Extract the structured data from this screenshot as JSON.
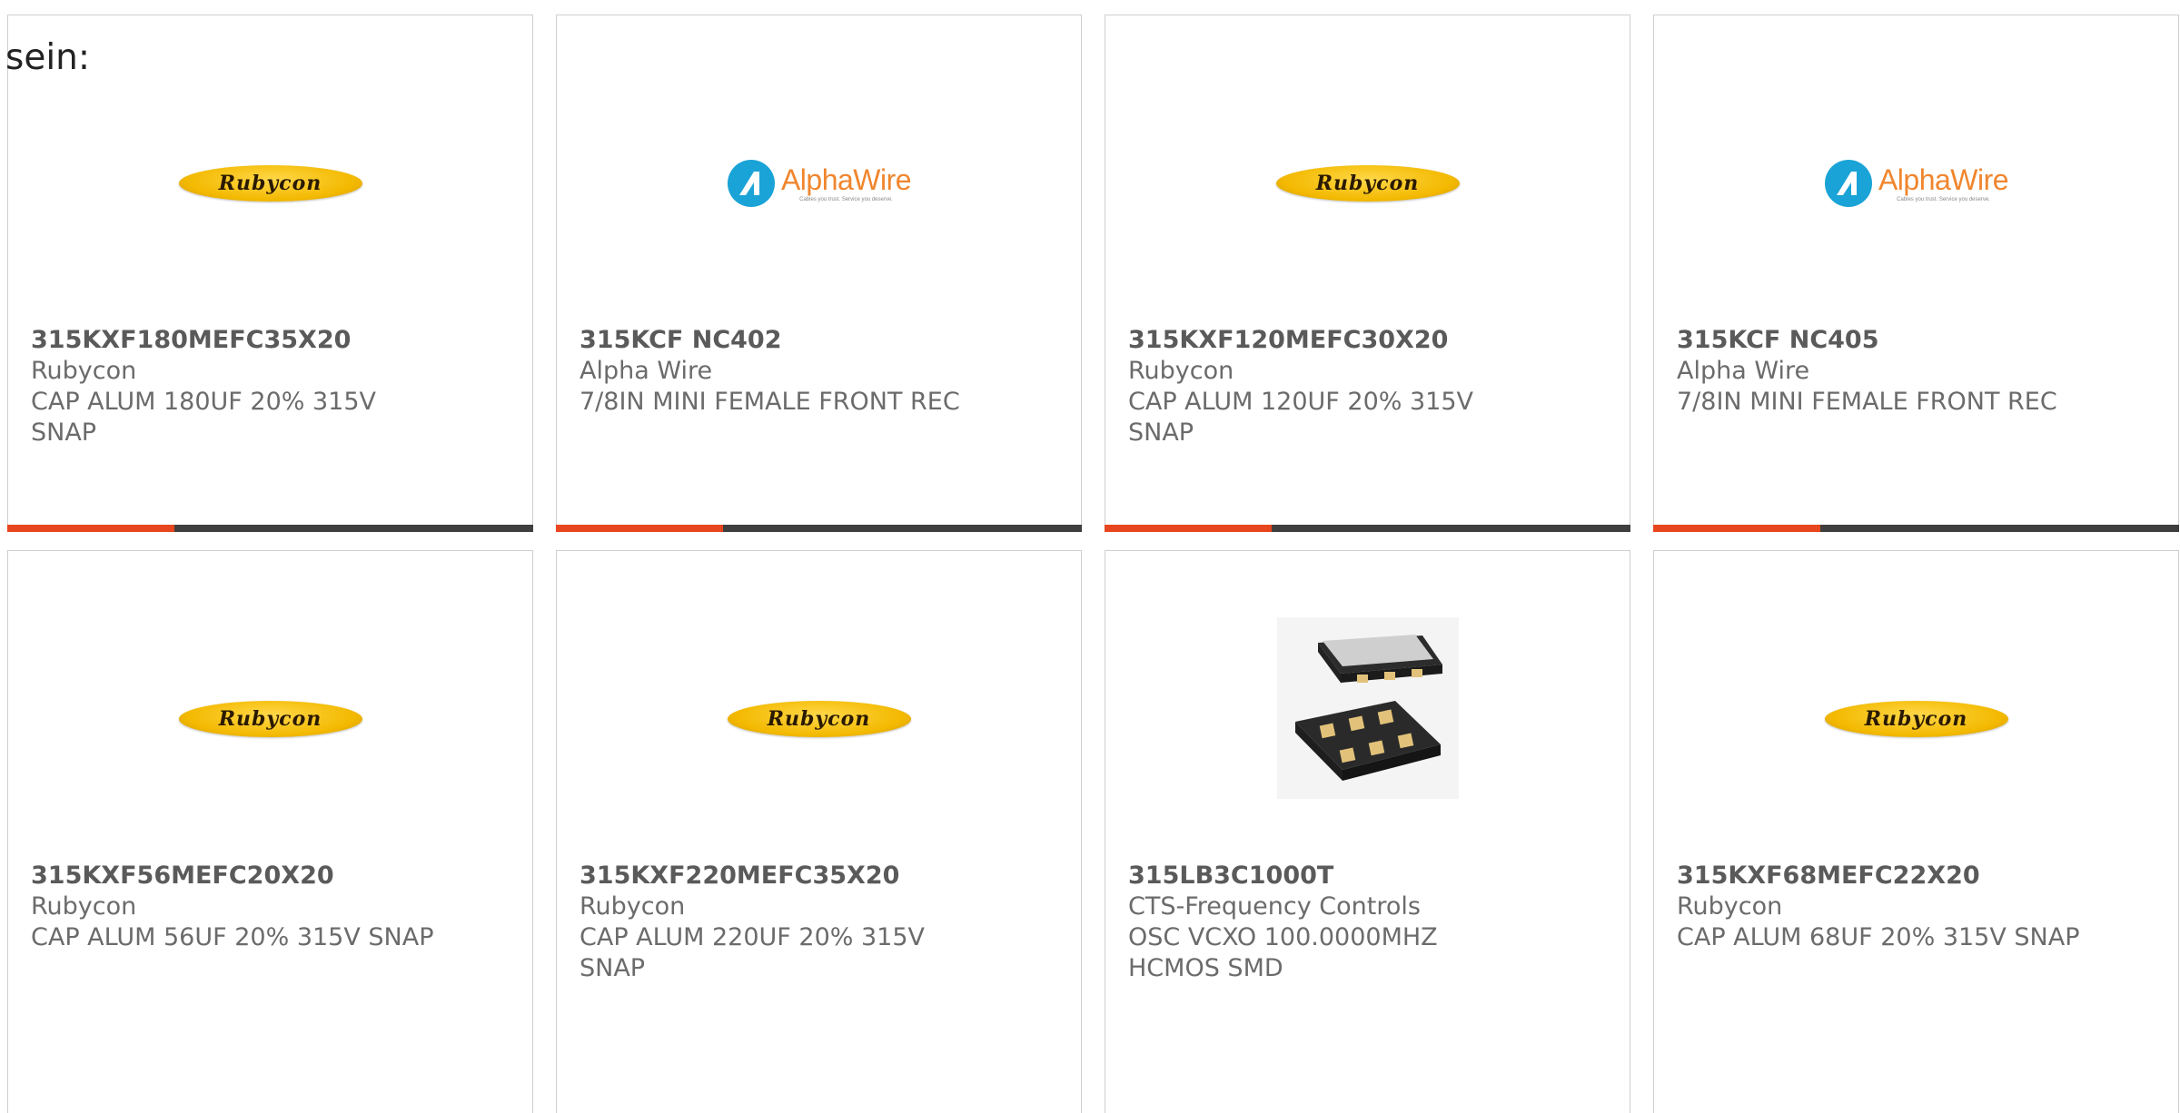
{
  "intro_text": "sein:",
  "colors": {
    "accent": "#e8461e",
    "bar": "#3f3f3f",
    "border": "#cfcfcf",
    "rubycon_yellow": "#f3b900",
    "alphawire_orange": "#f0862e",
    "alphawire_blue": "#1aa3d6"
  },
  "logos": {
    "rubycon": "Rubycon",
    "alphawire": "AlphaWire",
    "alphawire_tagline": "Cables you trust. Service you deserve."
  },
  "products": [
    {
      "part_number": "315KXF180MEFC35X20",
      "manufacturer": "Rubycon",
      "description": "CAP ALUM 180UF 20% 315V SNAP",
      "image": "rubycon-logo"
    },
    {
      "part_number": "315KCF NC402",
      "manufacturer": "Alpha Wire",
      "description": "7/8IN MINI FEMALE FRONT REC",
      "image": "alphawire-logo"
    },
    {
      "part_number": "315KXF120MEFC30X20",
      "manufacturer": "Rubycon",
      "description": "CAP ALUM 120UF 20% 315V SNAP",
      "image": "rubycon-logo"
    },
    {
      "part_number": "315KCF NC405",
      "manufacturer": "Alpha Wire",
      "description": "7/8IN MINI FEMALE FRONT REC",
      "image": "alphawire-logo"
    },
    {
      "part_number": "315KXF56MEFC20X20",
      "manufacturer": "Rubycon",
      "description": "CAP ALUM 56UF 20% 315V SNAP",
      "image": "rubycon-logo"
    },
    {
      "part_number": "315KXF220MEFC35X20",
      "manufacturer": "Rubycon",
      "description": "CAP ALUM 220UF 20% 315V SNAP",
      "image": "rubycon-logo"
    },
    {
      "part_number": "315LB3C1000T",
      "manufacturer": "CTS-Frequency Controls",
      "description": "OSC VCXO 100.0000MHZ HCMOS SMD",
      "image": "oscillator-chip-photo"
    },
    {
      "part_number": "315KXF68MEFC22X20",
      "manufacturer": "Rubycon",
      "description": "CAP ALUM 68UF 20% 315V SNAP",
      "image": "rubycon-logo"
    }
  ]
}
